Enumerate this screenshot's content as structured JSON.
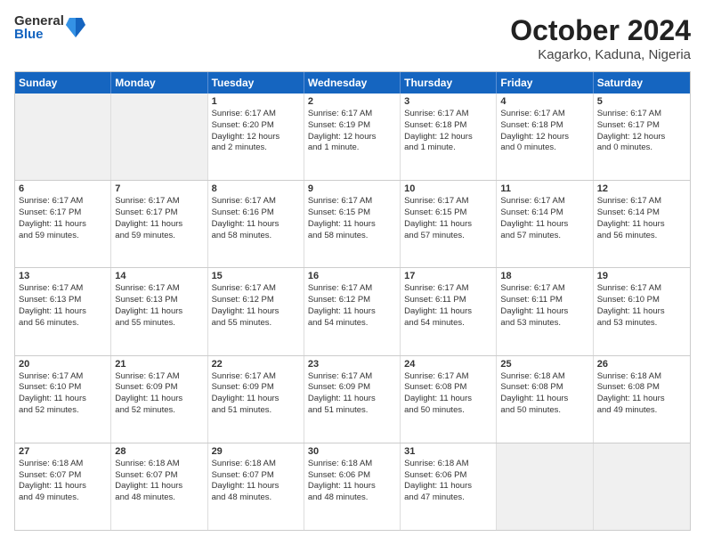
{
  "header": {
    "logo_general": "General",
    "logo_blue": "Blue",
    "title": "October 2024",
    "subtitle": "Kagarko, Kaduna, Nigeria"
  },
  "weekdays": [
    "Sunday",
    "Monday",
    "Tuesday",
    "Wednesday",
    "Thursday",
    "Friday",
    "Saturday"
  ],
  "rows": [
    [
      {
        "day": "",
        "lines": []
      },
      {
        "day": "",
        "lines": []
      },
      {
        "day": "1",
        "lines": [
          "Sunrise: 6:17 AM",
          "Sunset: 6:20 PM",
          "Daylight: 12 hours",
          "and 2 minutes."
        ]
      },
      {
        "day": "2",
        "lines": [
          "Sunrise: 6:17 AM",
          "Sunset: 6:19 PM",
          "Daylight: 12 hours",
          "and 1 minute."
        ]
      },
      {
        "day": "3",
        "lines": [
          "Sunrise: 6:17 AM",
          "Sunset: 6:18 PM",
          "Daylight: 12 hours",
          "and 1 minute."
        ]
      },
      {
        "day": "4",
        "lines": [
          "Sunrise: 6:17 AM",
          "Sunset: 6:18 PM",
          "Daylight: 12 hours",
          "and 0 minutes."
        ]
      },
      {
        "day": "5",
        "lines": [
          "Sunrise: 6:17 AM",
          "Sunset: 6:17 PM",
          "Daylight: 12 hours",
          "and 0 minutes."
        ]
      }
    ],
    [
      {
        "day": "6",
        "lines": [
          "Sunrise: 6:17 AM",
          "Sunset: 6:17 PM",
          "Daylight: 11 hours",
          "and 59 minutes."
        ]
      },
      {
        "day": "7",
        "lines": [
          "Sunrise: 6:17 AM",
          "Sunset: 6:17 PM",
          "Daylight: 11 hours",
          "and 59 minutes."
        ]
      },
      {
        "day": "8",
        "lines": [
          "Sunrise: 6:17 AM",
          "Sunset: 6:16 PM",
          "Daylight: 11 hours",
          "and 58 minutes."
        ]
      },
      {
        "day": "9",
        "lines": [
          "Sunrise: 6:17 AM",
          "Sunset: 6:15 PM",
          "Daylight: 11 hours",
          "and 58 minutes."
        ]
      },
      {
        "day": "10",
        "lines": [
          "Sunrise: 6:17 AM",
          "Sunset: 6:15 PM",
          "Daylight: 11 hours",
          "and 57 minutes."
        ]
      },
      {
        "day": "11",
        "lines": [
          "Sunrise: 6:17 AM",
          "Sunset: 6:14 PM",
          "Daylight: 11 hours",
          "and 57 minutes."
        ]
      },
      {
        "day": "12",
        "lines": [
          "Sunrise: 6:17 AM",
          "Sunset: 6:14 PM",
          "Daylight: 11 hours",
          "and 56 minutes."
        ]
      }
    ],
    [
      {
        "day": "13",
        "lines": [
          "Sunrise: 6:17 AM",
          "Sunset: 6:13 PM",
          "Daylight: 11 hours",
          "and 56 minutes."
        ]
      },
      {
        "day": "14",
        "lines": [
          "Sunrise: 6:17 AM",
          "Sunset: 6:13 PM",
          "Daylight: 11 hours",
          "and 55 minutes."
        ]
      },
      {
        "day": "15",
        "lines": [
          "Sunrise: 6:17 AM",
          "Sunset: 6:12 PM",
          "Daylight: 11 hours",
          "and 55 minutes."
        ]
      },
      {
        "day": "16",
        "lines": [
          "Sunrise: 6:17 AM",
          "Sunset: 6:12 PM",
          "Daylight: 11 hours",
          "and 54 minutes."
        ]
      },
      {
        "day": "17",
        "lines": [
          "Sunrise: 6:17 AM",
          "Sunset: 6:11 PM",
          "Daylight: 11 hours",
          "and 54 minutes."
        ]
      },
      {
        "day": "18",
        "lines": [
          "Sunrise: 6:17 AM",
          "Sunset: 6:11 PM",
          "Daylight: 11 hours",
          "and 53 minutes."
        ]
      },
      {
        "day": "19",
        "lines": [
          "Sunrise: 6:17 AM",
          "Sunset: 6:10 PM",
          "Daylight: 11 hours",
          "and 53 minutes."
        ]
      }
    ],
    [
      {
        "day": "20",
        "lines": [
          "Sunrise: 6:17 AM",
          "Sunset: 6:10 PM",
          "Daylight: 11 hours",
          "and 52 minutes."
        ]
      },
      {
        "day": "21",
        "lines": [
          "Sunrise: 6:17 AM",
          "Sunset: 6:09 PM",
          "Daylight: 11 hours",
          "and 52 minutes."
        ]
      },
      {
        "day": "22",
        "lines": [
          "Sunrise: 6:17 AM",
          "Sunset: 6:09 PM",
          "Daylight: 11 hours",
          "and 51 minutes."
        ]
      },
      {
        "day": "23",
        "lines": [
          "Sunrise: 6:17 AM",
          "Sunset: 6:09 PM",
          "Daylight: 11 hours",
          "and 51 minutes."
        ]
      },
      {
        "day": "24",
        "lines": [
          "Sunrise: 6:17 AM",
          "Sunset: 6:08 PM",
          "Daylight: 11 hours",
          "and 50 minutes."
        ]
      },
      {
        "day": "25",
        "lines": [
          "Sunrise: 6:18 AM",
          "Sunset: 6:08 PM",
          "Daylight: 11 hours",
          "and 50 minutes."
        ]
      },
      {
        "day": "26",
        "lines": [
          "Sunrise: 6:18 AM",
          "Sunset: 6:08 PM",
          "Daylight: 11 hours",
          "and 49 minutes."
        ]
      }
    ],
    [
      {
        "day": "27",
        "lines": [
          "Sunrise: 6:18 AM",
          "Sunset: 6:07 PM",
          "Daylight: 11 hours",
          "and 49 minutes."
        ]
      },
      {
        "day": "28",
        "lines": [
          "Sunrise: 6:18 AM",
          "Sunset: 6:07 PM",
          "Daylight: 11 hours",
          "and 48 minutes."
        ]
      },
      {
        "day": "29",
        "lines": [
          "Sunrise: 6:18 AM",
          "Sunset: 6:07 PM",
          "Daylight: 11 hours",
          "and 48 minutes."
        ]
      },
      {
        "day": "30",
        "lines": [
          "Sunrise: 6:18 AM",
          "Sunset: 6:06 PM",
          "Daylight: 11 hours",
          "and 48 minutes."
        ]
      },
      {
        "day": "31",
        "lines": [
          "Sunrise: 6:18 AM",
          "Sunset: 6:06 PM",
          "Daylight: 11 hours",
          "and 47 minutes."
        ]
      },
      {
        "day": "",
        "lines": []
      },
      {
        "day": "",
        "lines": []
      }
    ]
  ]
}
